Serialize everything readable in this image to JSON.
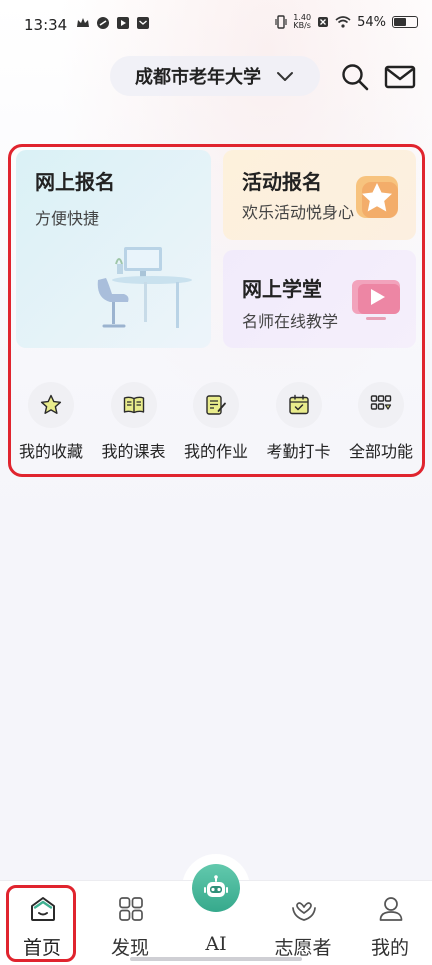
{
  "status_bar": {
    "time": "13:34",
    "net_speed_value": "1.40",
    "net_speed_unit": "KB/s",
    "battery_percent": "54%",
    "battery_level": 0.54
  },
  "header": {
    "school_name": "成都市老年大学",
    "icons": [
      "chevron-down-icon",
      "search-icon",
      "mail-icon"
    ]
  },
  "cards": {
    "signup": {
      "title": "网上报名",
      "subtitle": "方便快捷",
      "icon": "desk-illustration"
    },
    "activity": {
      "title": "活动报名",
      "subtitle": "欢乐活动悦身心",
      "icon": "star-icon"
    },
    "school": {
      "title": "网上学堂",
      "subtitle": "名师在线教学",
      "icon": "video-icon"
    }
  },
  "tools": [
    {
      "label": "我的收藏",
      "icon": "star-icon"
    },
    {
      "label": "我的课表",
      "icon": "book-icon"
    },
    {
      "label": "我的作业",
      "icon": "homework-icon"
    },
    {
      "label": "考勤打卡",
      "icon": "calendar-check-icon"
    },
    {
      "label": "全部功能",
      "icon": "grid-icon"
    }
  ],
  "bottom_nav": [
    {
      "label": "首页",
      "icon": "home-icon",
      "active": true
    },
    {
      "label": "发现",
      "icon": "discover-grid-icon",
      "active": false
    },
    {
      "label": "AI",
      "icon": "robot-icon",
      "active": false
    },
    {
      "label": "志愿者",
      "icon": "heart-hand-icon",
      "active": false
    },
    {
      "label": "我的",
      "icon": "user-icon",
      "active": false
    }
  ],
  "colors": {
    "accent_green": "#3fb091",
    "highlight_red": "#e0242e",
    "signup_card": "#daf1f6",
    "activity_card": "#fdf1dc",
    "school_card": "#f1ebfb"
  }
}
